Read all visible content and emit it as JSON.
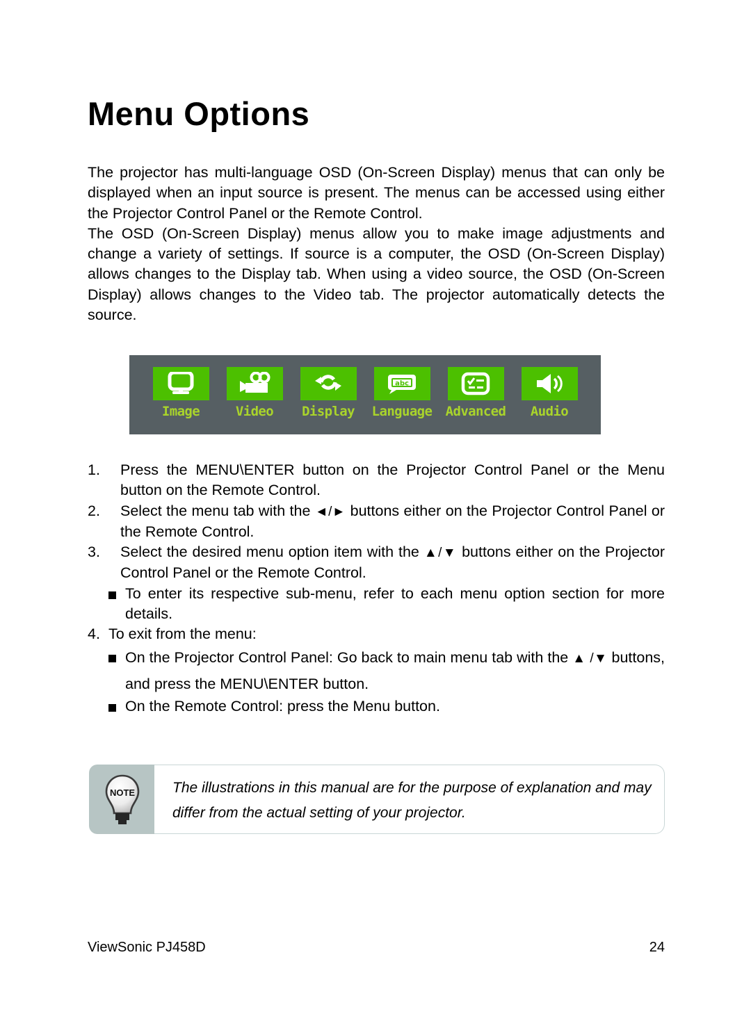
{
  "document": {
    "title": "Menu Options",
    "intro_paragraphs": [
      "The projector has multi-language OSD (On-Screen Display) menus that can only be displayed when an input source is present. The menus can be accessed using either the Projector Control Panel or the Remote Control.",
      "The OSD (On-Screen Display) menus allow you to make image adjustments and change a variety of settings. If source is a computer, the OSD (On-Screen Display) allows changes to the Display tab. When using a video source, the OSD (On-Screen Display) allows changes to the Video tab. The projector automatically detects the source."
    ]
  },
  "osd_bar": {
    "background_color": "#565f63",
    "tile_color": "#4cc000",
    "label_color": "#a9d42b",
    "items": [
      {
        "label": "Image",
        "icon": "monitor-icon"
      },
      {
        "label": "Video",
        "icon": "movie-camera-icon"
      },
      {
        "label": "Display",
        "icon": "refresh-arrows-icon"
      },
      {
        "label": "Language",
        "icon": "abc-speech-bubble-icon"
      },
      {
        "label": "Advanced",
        "icon": "checklist-screen-icon"
      },
      {
        "label": "Audio",
        "icon": "speaker-icon"
      }
    ]
  },
  "steps": [
    {
      "number": "1.",
      "text": "Press the MENU\\ENTER button on the Projector Control Panel or the Menu button on the Remote Control."
    },
    {
      "number": "2.",
      "text_before": "Select the menu tab with the ",
      "arrows": "◄/►",
      "text_after": " buttons either on the Projector Control Panel or the Remote Control."
    },
    {
      "number": "3.",
      "text_before": "Select the desired menu option item with the ",
      "arrows": "▲/▼",
      "text_after": " buttons either on the Projector Control Panel or the Remote Control.",
      "sub_items": [
        {
          "text": "To enter its respective sub-menu, refer to each menu option section for more details."
        }
      ]
    },
    {
      "number": "4.",
      "text": "To exit from the menu:",
      "sub_items": [
        {
          "text_before": "On the Projector Control Panel: Go back to main menu tab with the ",
          "arrows": "▲ /▼",
          "text_after": " buttons, and press the MENU\\ENTER button."
        },
        {
          "text": "On the Remote Control: press the Menu button."
        }
      ]
    }
  ],
  "note": {
    "badge_label": "NOTE",
    "panel_color": "#b7c5c4",
    "line1": "The illustrations in this manual are for the purpose of explanation and may",
    "line2": "differ from the actual setting of your projector."
  },
  "footer": {
    "product": "ViewSonic PJ458D",
    "page_number": "24"
  }
}
